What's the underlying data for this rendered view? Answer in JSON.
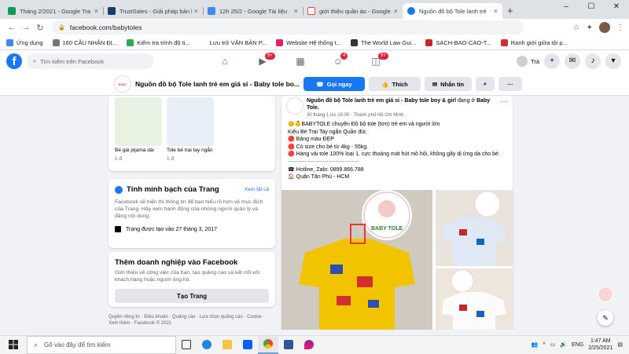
{
  "browser": {
    "tabs": [
      {
        "label": "Tháng 2/2021 - Google Tra",
        "color": "#0f9d58"
      },
      {
        "label": "TrustSales - Giải pháp bán h",
        "color": "#1a3a6b"
      },
      {
        "label": "12h 25/2 - Google Tài liệu",
        "color": "#4285f4"
      },
      {
        "label": "giới thiệu quần áo - Google",
        "color": "#ea4335"
      },
      {
        "label": "Nguồn đồ bộ Tole lanh trẻ",
        "color": "#1877f2"
      }
    ],
    "new_tab": "+",
    "url": "facebook.com/babytoles",
    "bookmarks": [
      {
        "label": "Ứng dụng",
        "color": "#4285f4"
      },
      {
        "label": "160 CÂU NHẬN ĐỊ...",
        "color": "#777777"
      },
      {
        "label": "Kiểm tra trình độ ti...",
        "color": "#34a853"
      },
      {
        "label": "Lưu trữ VĂN BẢN P...",
        "color": "#ffffff"
      },
      {
        "label": "Website Hệ thống t...",
        "color": "#e91e63"
      },
      {
        "label": "The World Law Gui...",
        "color": "#333333"
      },
      {
        "label": "SACH-BAO-CAO-T...",
        "color": "#c62828"
      },
      {
        "label": "Ranh giới giữa tội p...",
        "color": "#d32f2f"
      }
    ]
  },
  "facebook": {
    "search_placeholder": "Tìm kiếm trên Facebook",
    "nav_badges": [
      "9+",
      "4",
      "9+"
    ],
    "profile_name": "Trà",
    "page_name": "Nguồn đồ bộ Tole lanh trẻ em giá sỉ - Baby tole bo...",
    "page_logo_text": "BABY TOLE",
    "btn_call": "Gọi ngay",
    "btn_like": "Thích",
    "btn_message": "Nhắn tin",
    "btn_search": "⌕",
    "btn_more": "···"
  },
  "left": {
    "photos": [
      {
        "caption": "Bé gái pijama dài",
        "count": "1 đ"
      },
      {
        "caption": "Tole bé trai tay ngắn",
        "count": "1 đ"
      }
    ],
    "transparency": {
      "title": "Tính minh bạch của Trang",
      "see_all": "Xem tất cả",
      "text": "Facebook sẽ hiển thị thông tin để bạn hiểu rõ hơn về mục đích của Trang. Hãy xem hành động của những người quản lý và đăng nội dung.",
      "fact": "Trang được tạo vào 27 tháng 3, 2017"
    },
    "add_business": {
      "title": "Thêm doanh nghiệp vào Facebook",
      "text": "Giới thiệu về công việc của bạn, tạo quảng cáo và kết nối với khách hàng hoặc người ủng hộ.",
      "button": "Tạo Trang"
    },
    "legal": "Quyền riêng tư · Điều khoản · Quảng cáo · Lựa chọn quảng cáo · Cookie · Xem thêm · Facebook © 2021"
  },
  "post": {
    "author": "Nguồn đồ bộ Tole lanh trẻ em giá sỉ - Baby tole boy & girl",
    "author_action": "đang ở",
    "location": "Baby Tole.",
    "meta": "30 tháng 1 lúc 15:00 · Thành phố Hồ Chí Minh ·",
    "more": "···",
    "lines": [
      "😊👶BABYTOLE chuyên Đồ bộ tole (tơn) trẻ em và người lớn",
      "Kiểu Bé Trai Tay ngắn Quần đùi:",
      "🔴 Bảng màu ĐẸP",
      "🔴 Có size cho bé từ 4kg - 55kg.",
      "🔴 Hàng vải tole 100% loại 1, cực thoáng mát hút mồ hôi, không gây dị ứng da cho bé.",
      "---------------------------------------",
      "☎ Hotline, Zalo: 0899.866.788",
      "🏠 Quận Tân Phú - HCM"
    ],
    "image_logo": "BABY TOLE"
  },
  "taskbar": {
    "search": "Gõ vào đây để tìm kiếm",
    "lang": "ENG",
    "time": "1:47 AM",
    "date": "2/25/2021"
  }
}
